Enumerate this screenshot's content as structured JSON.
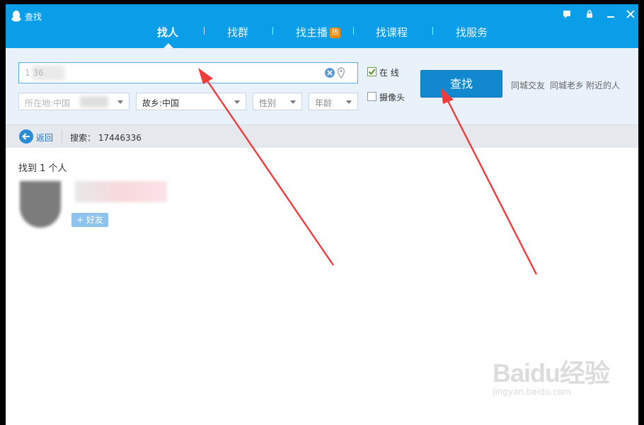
{
  "window": {
    "title": "查找"
  },
  "tabs": [
    {
      "label": "找人"
    },
    {
      "label": "找群"
    },
    {
      "label": "找主播",
      "badge": "热"
    },
    {
      "label": "找课程"
    },
    {
      "label": "找服务"
    }
  ],
  "search": {
    "value": "1   36"
  },
  "filters": {
    "location": "所在地:中国",
    "hometown": "故乡:中国",
    "gender": "性别",
    "age": "年龄"
  },
  "options": {
    "online_label": "在 线",
    "online_checked": true,
    "camera_label": "摄像头",
    "camera_checked": false
  },
  "find_button": "查找",
  "quick_links": [
    "同城交友",
    "同城老乡",
    "附近的人"
  ],
  "nav": {
    "back_label": "返回",
    "search_summary": "搜索： 17446336"
  },
  "results": {
    "count_text": "找到 1 个人",
    "add_friend_label": "+ 好友"
  },
  "watermark": {
    "logo": "Baidu经验",
    "url": "jingyan.baidu.com"
  },
  "colors": {
    "title_bar": "#0a9ee8",
    "filter_bg": "#e9f2fb",
    "find_button": "#1289cf",
    "annotation_arrow": "#ef3b3b"
  }
}
